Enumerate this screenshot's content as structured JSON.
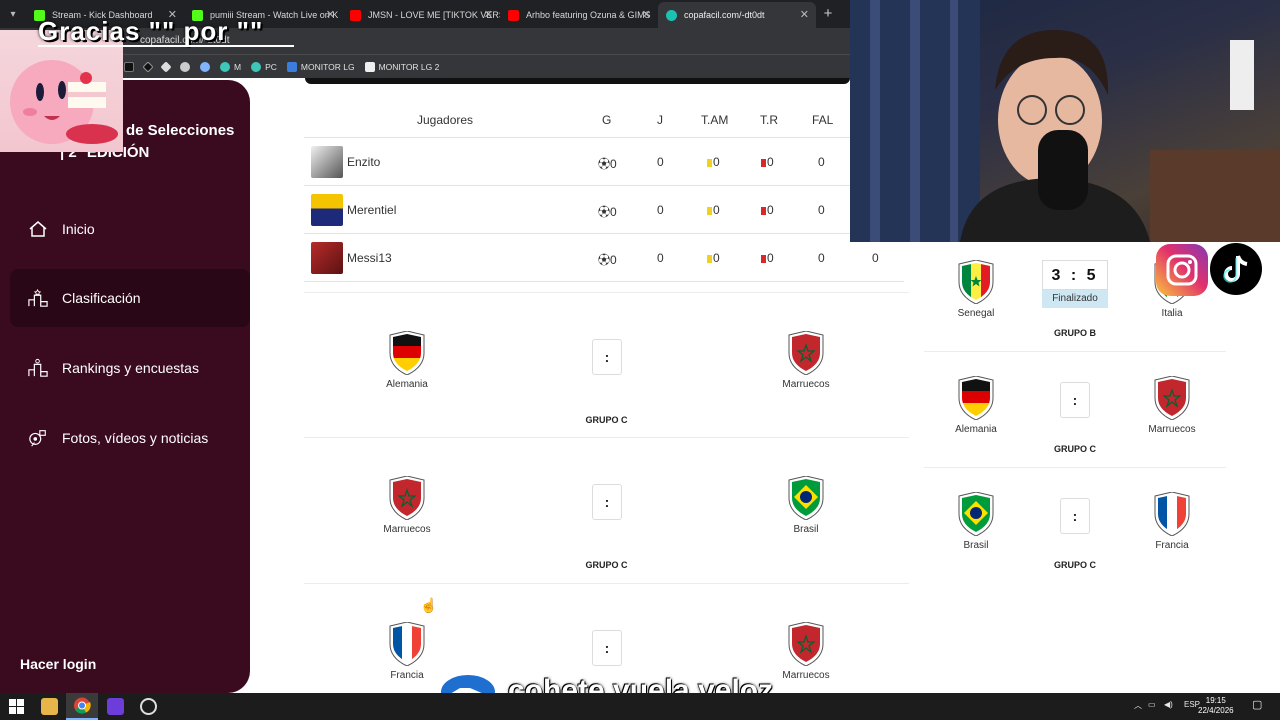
{
  "browser": {
    "tabs": [
      {
        "label": "Stream - Kick Dashboard",
        "color": "#53fc18"
      },
      {
        "label": "pumiii Stream - Watch Live on K",
        "color": "#53fc18"
      },
      {
        "label": "JMSN - LOVE ME [TIKTOK VERS",
        "color": "#ff0000"
      },
      {
        "label": "Arhbo featuring Ozuna & GIMS",
        "color": "#ff0000"
      },
      {
        "label": "copafacil.com/-dt0dt",
        "color": "#19c3b3"
      }
    ],
    "url": "copafacil.com/-dt0dt",
    "bookmarks": [
      {
        "label": "M",
        "icon": "m-icon"
      },
      {
        "label": "PC",
        "icon": "pc-icon"
      },
      {
        "label": "MONITOR LG",
        "icon": "monitor-icon"
      },
      {
        "label": "MONITOR LG 2",
        "icon": "monitor-icon"
      }
    ]
  },
  "overlay": {
    "gracias": "Gracias \"\" por \"\"",
    "banner": "cohete.vuela.veloz"
  },
  "sidebar": {
    "title_line1": "de Selecciones",
    "title_line2": "| 2° EDICIÓN",
    "items": [
      {
        "label": "Inicio",
        "icon": "home-icon"
      },
      {
        "label": "Clasificación",
        "icon": "podium-icon",
        "active": true
      },
      {
        "label": "Rankings y encuestas",
        "icon": "ranking-icon"
      },
      {
        "label": "Fotos, vídeos y noticias",
        "icon": "media-icon"
      }
    ],
    "login": "Hacer login"
  },
  "players_table": {
    "headers": [
      "Jugadores",
      "G",
      "J",
      "T.AM",
      "T.R",
      "FAL"
    ],
    "rows": [
      {
        "name": "Enzito",
        "g": "0",
        "j": "0",
        "tam": "0",
        "tr": "0",
        "fal": "0"
      },
      {
        "name": "Merentiel",
        "g": "0",
        "j": "0",
        "tam": "0",
        "tr": "0",
        "fal": "0"
      },
      {
        "name": "Messi13",
        "g": "0",
        "j": "0",
        "tam": "0",
        "tr": "0",
        "fal": "0",
        "extra": "0"
      }
    ]
  },
  "matches": [
    {
      "home": "Alemania",
      "away": "Marruecos",
      "score": ":",
      "group": "GRUPO C"
    },
    {
      "home": "Marruecos",
      "away": "Brasil",
      "score": ":",
      "group": "GRUPO C"
    },
    {
      "home": "Francia",
      "away": "Marruecos",
      "score": ":",
      "group": ""
    }
  ],
  "right_panel": {
    "final_match": {
      "home": "Senegal",
      "away": "Italia",
      "score": "3 : 5",
      "status": "Finalizado",
      "group": "GRUPO B"
    },
    "matches": [
      {
        "home": "Alemania",
        "away": "Marruecos",
        "score": ":",
        "group": "GRUPO C"
      },
      {
        "home": "Brasil",
        "away": "Francia",
        "score": ":",
        "group": "GRUPO C"
      }
    ]
  },
  "taskbar": {
    "lang": "ESP",
    "time": "19:15",
    "date": "22/4/2026"
  }
}
